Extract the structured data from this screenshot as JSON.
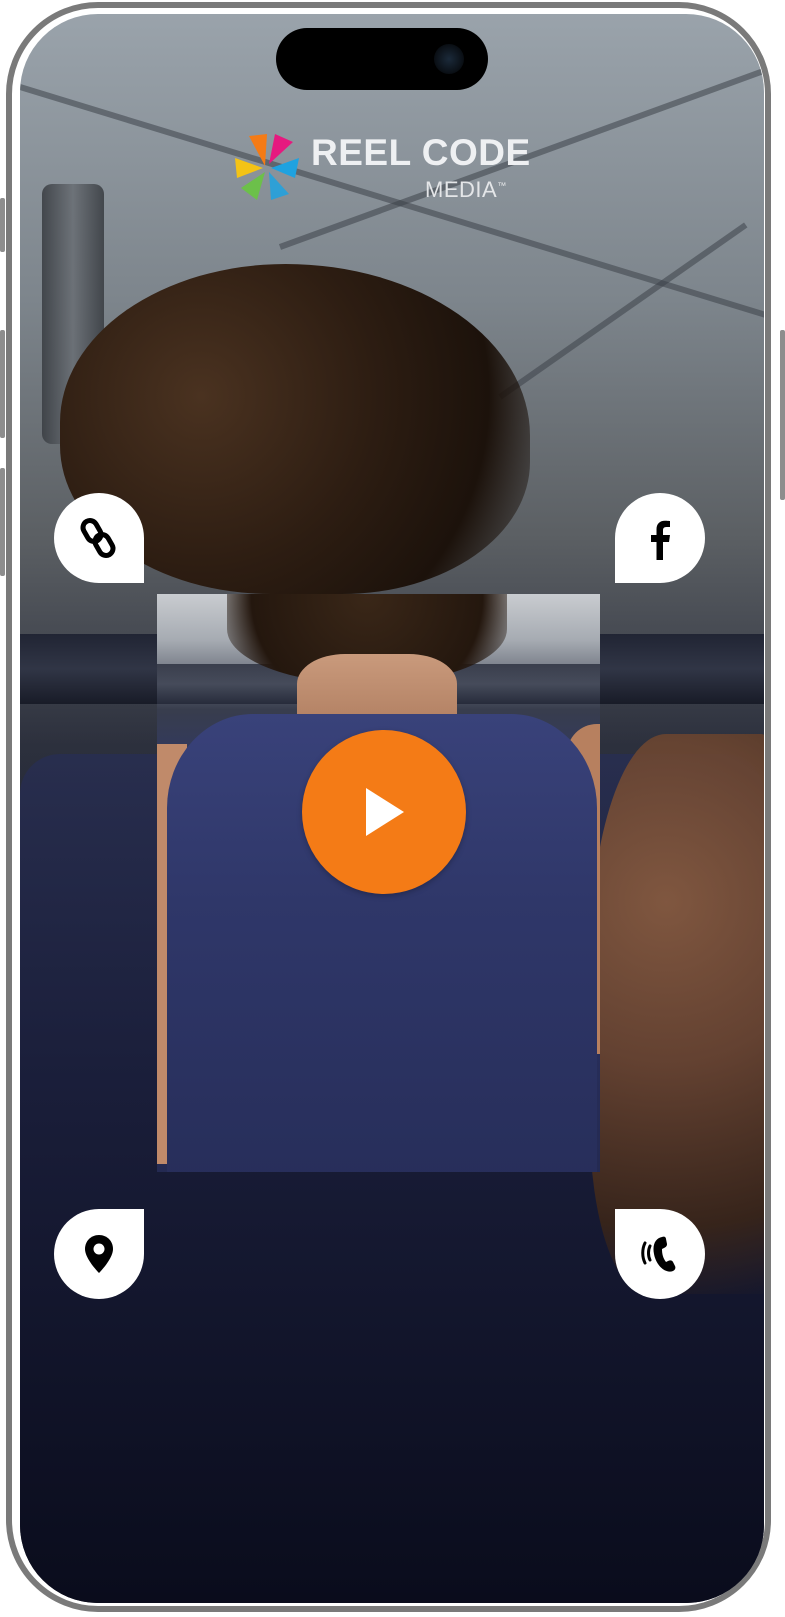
{
  "brand": {
    "name": "REEL CODE",
    "sub": "MEDIA",
    "trademark": "™",
    "logo_colors": [
      "#f47b16",
      "#e6197f",
      "#1fa2e0",
      "#f4c316",
      "#6cc04a"
    ]
  },
  "actions": {
    "link": {
      "icon": "link-icon"
    },
    "facebook": {
      "icon": "facebook-icon"
    },
    "location": {
      "icon": "location-pin-icon"
    },
    "phone": {
      "icon": "phone-call-icon"
    }
  },
  "video": {
    "play_icon": "play-icon",
    "accent_color": "#f47b16"
  }
}
